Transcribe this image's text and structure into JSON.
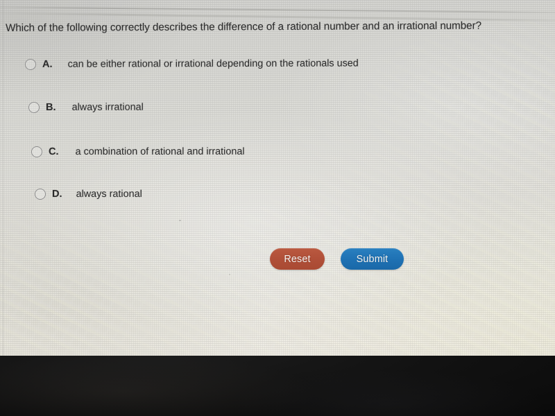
{
  "question": {
    "text": "Which of the following correctly describes the difference of a rational number and an irrational number?"
  },
  "options": [
    {
      "letter": "A.",
      "text": "can be either rational or irrational depending on the rationals used",
      "selected": false
    },
    {
      "letter": "B.",
      "text": "always irrational",
      "selected": false
    },
    {
      "letter": "C.",
      "text": "a combination of rational and irrational",
      "selected": false
    },
    {
      "letter": "D.",
      "text": "always rational",
      "selected": false
    }
  ],
  "buttons": {
    "reset_label": "Reset",
    "submit_label": "Submit"
  },
  "colors": {
    "reset_background": "#b04f38",
    "submit_background": "#1f72b4",
    "button_text": "#f4f2ef",
    "screen_background": "#ddddd7",
    "text": "#2d2d2d",
    "radio_border": "#8d8d8d",
    "bezel": "#0d0d0d"
  }
}
